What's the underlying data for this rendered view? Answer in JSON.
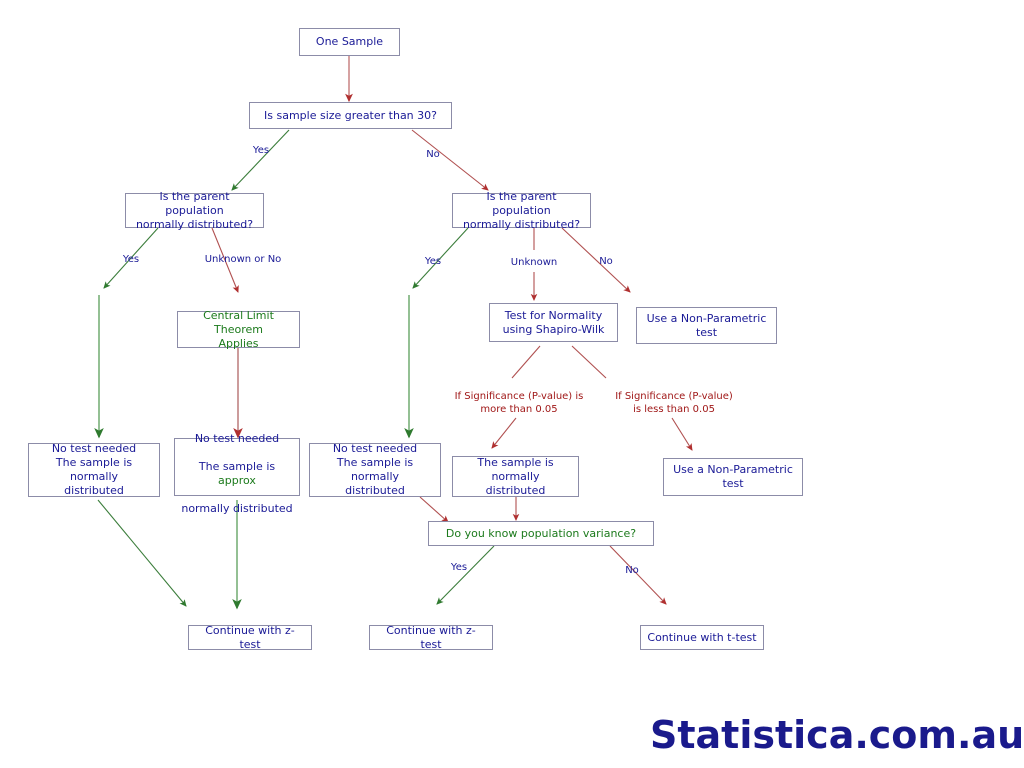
{
  "diagram": {
    "title": "One Sample statistical test decision flowchart",
    "colors": {
      "node_text": "#1a1a96",
      "node_text_green": "#1c7a1c",
      "node_border": "#8c8ca8",
      "arrow_yes": "#2f7a2f",
      "arrow_no": "#b03030",
      "arrow_no_light": "#c08080",
      "label_text": "#1a1a96",
      "label_sig": "#a01818",
      "brand": "#1a1a8c",
      "background": "#ffffff"
    }
  },
  "nodes": {
    "one_sample": "One Sample",
    "sample_size": "Is sample size greater than 30?",
    "parent_pop_left": "Is the parent population\nnormally distributed?",
    "parent_pop_right": "Is the parent population\nnormally distributed?",
    "clt": "Central Limit Theorem\nApplies",
    "shapiro": "Test for Normality\nusing Shapiro-Wilk",
    "nonparam_upper": "Use a Non-Parametric\ntest",
    "no_test_1": "No test needed\nThe sample is normally\ndistributed",
    "no_test_2_line1": "No test needed",
    "no_test_2_line2_pre": "The sample is ",
    "no_test_2_approx": "approx",
    "no_test_2_line3": "normally distributed",
    "no_test_3": "No test needed\nThe sample is normally\ndistributed",
    "sample_normal": "The sample is normally\ndistributed",
    "nonparam_lower": "Use a Non-Parametric\ntest",
    "variance": "Do you know population variance?",
    "z_test_1": "Continue with z-test",
    "z_test_2": "Continue with z-test",
    "t_test": "Continue with t-test"
  },
  "edge_labels": {
    "yes_top": "Yes",
    "no_top": "No",
    "yes_left": "Yes",
    "unknown_or_no": "Unknown or No",
    "yes_right": "Yes",
    "unknown": "Unknown",
    "no_right": "No",
    "sig_more": "If Significance (P-value) is\nmore than 0.05",
    "sig_less": "If Significance (P-value)\nis less than 0.05",
    "yes_variance": "Yes",
    "no_variance": "No"
  },
  "brand": {
    "text": "Statistica.com.au"
  }
}
